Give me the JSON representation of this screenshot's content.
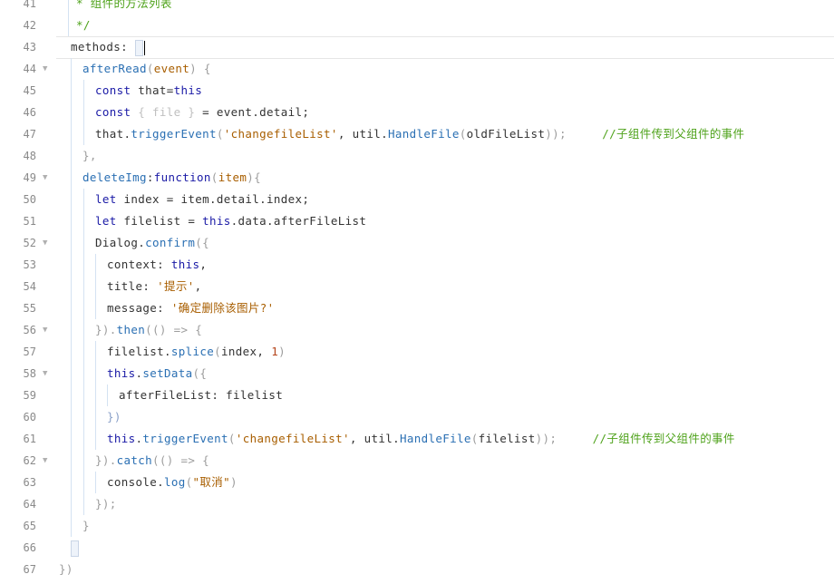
{
  "editor": {
    "language": "javascript",
    "active_line": 43,
    "lines": [
      {
        "n": "41",
        "parts": [
          {
            "t": "* 组件的方法列表",
            "c": "t-gcmt"
          }
        ]
      },
      {
        "n": "42",
        "parts": [
          {
            "t": "*/",
            "c": "t-gcmt"
          }
        ]
      },
      {
        "n": "43",
        "parts": [
          {
            "t": "methods: ",
            "c": "t-def"
          }
        ]
      },
      {
        "n": "44",
        "parts": [
          {
            "t": "afterRead",
            "c": "t-fn"
          },
          {
            "t": "(",
            "c": "t-pn"
          },
          {
            "t": "event",
            "c": "t-str"
          },
          {
            "t": ") {",
            "c": "t-pn"
          }
        ]
      },
      {
        "n": "45",
        "parts": [
          {
            "t": "const ",
            "c": "t-kw"
          },
          {
            "t": "that=",
            "c": "t-def"
          },
          {
            "t": "this",
            "c": "t-kw"
          }
        ]
      },
      {
        "n": "46",
        "parts": [
          {
            "t": "const ",
            "c": "t-kw"
          },
          {
            "t": "{ file } ",
            "c": "t-dim"
          },
          {
            "t": "= event.detail;",
            "c": "t-def"
          }
        ]
      },
      {
        "n": "47",
        "parts": [
          {
            "t": "that.",
            "c": "t-def"
          },
          {
            "t": "triggerEvent",
            "c": "t-fn"
          },
          {
            "t": "(",
            "c": "t-pn"
          },
          {
            "t": "'changefileList'",
            "c": "t-str"
          },
          {
            "t": ", util.",
            "c": "t-def"
          },
          {
            "t": "HandleFile",
            "c": "t-fn"
          },
          {
            "t": "(",
            "c": "t-pn"
          },
          {
            "t": "oldFileList",
            "c": "t-def"
          },
          {
            "t": "));",
            "c": "t-pn"
          },
          {
            "t": "     //子组件传到父组件的事件",
            "c": "t-cmt"
          }
        ]
      },
      {
        "n": "48",
        "parts": [
          {
            "t": "},",
            "c": "t-pn"
          }
        ]
      },
      {
        "n": "49",
        "parts": [
          {
            "t": "deleteImg",
            "c": "t-fn"
          },
          {
            "t": ":",
            "c": "t-def"
          },
          {
            "t": "function",
            "c": "t-kw"
          },
          {
            "t": "(",
            "c": "t-pn"
          },
          {
            "t": "item",
            "c": "t-str"
          },
          {
            "t": "){",
            "c": "t-pn"
          }
        ]
      },
      {
        "n": "50",
        "parts": [
          {
            "t": "let ",
            "c": "t-kw"
          },
          {
            "t": "index = item.detail.index;",
            "c": "t-def"
          }
        ]
      },
      {
        "n": "51",
        "parts": [
          {
            "t": "let ",
            "c": "t-kw"
          },
          {
            "t": "filelist = ",
            "c": "t-def"
          },
          {
            "t": "this",
            "c": "t-kw"
          },
          {
            "t": ".data.afterFileList",
            "c": "t-def"
          }
        ]
      },
      {
        "n": "52",
        "parts": [
          {
            "t": "Dialog.",
            "c": "t-def"
          },
          {
            "t": "confirm",
            "c": "t-fn"
          },
          {
            "t": "({",
            "c": "t-pn"
          }
        ]
      },
      {
        "n": "53",
        "parts": [
          {
            "t": "context: ",
            "c": "t-def"
          },
          {
            "t": "this",
            "c": "t-kw"
          },
          {
            "t": ",",
            "c": "t-def"
          }
        ]
      },
      {
        "n": "54",
        "parts": [
          {
            "t": "title: ",
            "c": "t-def"
          },
          {
            "t": "'提示'",
            "c": "t-str"
          },
          {
            "t": ",",
            "c": "t-def"
          }
        ]
      },
      {
        "n": "55",
        "parts": [
          {
            "t": "message: ",
            "c": "t-def"
          },
          {
            "t": "'确定删除该图片?'",
            "c": "t-str"
          }
        ]
      },
      {
        "n": "56",
        "parts": [
          {
            "t": "}).",
            "c": "t-pn"
          },
          {
            "t": "then",
            "c": "t-fn"
          },
          {
            "t": "(() => {",
            "c": "t-pn"
          }
        ]
      },
      {
        "n": "57",
        "parts": [
          {
            "t": "filelist.",
            "c": "t-def"
          },
          {
            "t": "splice",
            "c": "t-fn"
          },
          {
            "t": "(",
            "c": "t-pn"
          },
          {
            "t": "index, ",
            "c": "t-def"
          },
          {
            "t": "1",
            "c": "t-num"
          },
          {
            "t": ")",
            "c": "t-pn"
          }
        ]
      },
      {
        "n": "58",
        "parts": [
          {
            "t": "this",
            "c": "t-kw"
          },
          {
            "t": ".",
            "c": "t-def"
          },
          {
            "t": "setData",
            "c": "t-fn"
          },
          {
            "t": "({",
            "c": "t-pn"
          }
        ]
      },
      {
        "n": "59",
        "parts": [
          {
            "t": "afterFileList: filelist",
            "c": "t-def"
          }
        ]
      },
      {
        "n": "60",
        "parts": [
          {
            "t": "})",
            "c": "t-pn2"
          }
        ]
      },
      {
        "n": "61",
        "parts": [
          {
            "t": "this",
            "c": "t-kw"
          },
          {
            "t": ".",
            "c": "t-def"
          },
          {
            "t": "triggerEvent",
            "c": "t-fn"
          },
          {
            "t": "(",
            "c": "t-pn"
          },
          {
            "t": "'changefileList'",
            "c": "t-str"
          },
          {
            "t": ", util.",
            "c": "t-def"
          },
          {
            "t": "HandleFile",
            "c": "t-fn"
          },
          {
            "t": "(",
            "c": "t-pn"
          },
          {
            "t": "filelist",
            "c": "t-def"
          },
          {
            "t": "));",
            "c": "t-pn"
          },
          {
            "t": "     //子组件传到父组件的事件",
            "c": "t-cmt"
          }
        ]
      },
      {
        "n": "62",
        "parts": [
          {
            "t": "}).",
            "c": "t-pn"
          },
          {
            "t": "catch",
            "c": "t-fn"
          },
          {
            "t": "(() => {",
            "c": "t-pn"
          }
        ]
      },
      {
        "n": "63",
        "parts": [
          {
            "t": "console.",
            "c": "t-def"
          },
          {
            "t": "log",
            "c": "t-fn"
          },
          {
            "t": "(",
            "c": "t-pn"
          },
          {
            "t": "\"取消\"",
            "c": "t-str"
          },
          {
            "t": ")",
            "c": "t-pn"
          }
        ]
      },
      {
        "n": "64",
        "parts": [
          {
            "t": "});",
            "c": "t-pn"
          }
        ]
      },
      {
        "n": "65",
        "parts": [
          {
            "t": "}",
            "c": "t-pn"
          }
        ]
      },
      {
        "n": "66",
        "parts": [
          {
            "t": "",
            "c": "t-def"
          }
        ]
      },
      {
        "n": "67",
        "parts": [
          {
            "t": "})",
            "c": "t-pn"
          }
        ]
      }
    ]
  }
}
